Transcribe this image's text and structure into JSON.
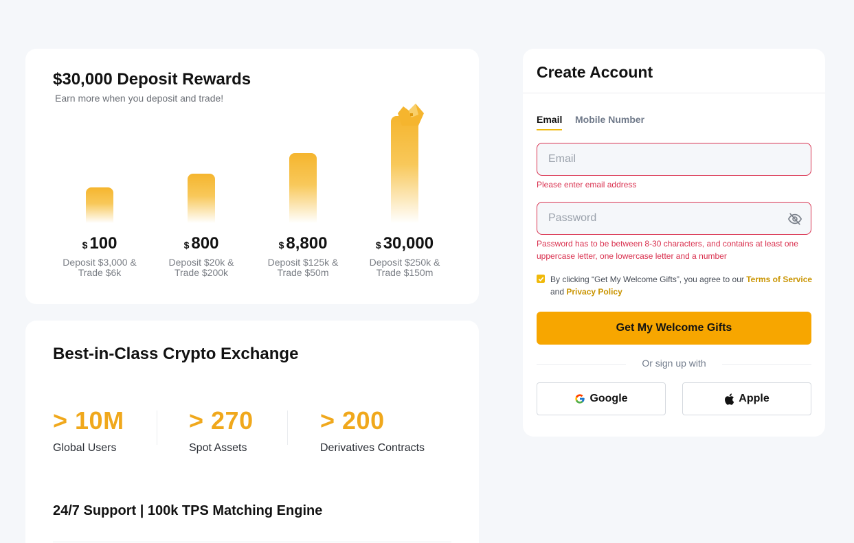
{
  "rewards": {
    "title": "$30,000 Deposit Rewards",
    "subtitle": "Earn more when you deposit and trade!",
    "tiers": [
      {
        "currency": "$",
        "amount": "100",
        "desc_line1": "Deposit $3,000 &",
        "desc_line2": "Trade $6k"
      },
      {
        "currency": "$",
        "amount": "800",
        "desc_line1": "Deposit $20k &",
        "desc_line2": "Trade $200k"
      },
      {
        "currency": "$",
        "amount": "8,800",
        "desc_line1": "Deposit $125k &",
        "desc_line2": "Trade $50m"
      },
      {
        "currency": "$",
        "amount": "30,000",
        "desc_line1": "Deposit $250k &",
        "desc_line2": "Trade $150m"
      }
    ]
  },
  "exchange": {
    "title": "Best-in-Class Crypto Exchange",
    "stats": [
      {
        "value": "> 10M",
        "label": "Global Users"
      },
      {
        "value": "> 270",
        "label": "Spot Assets"
      },
      {
        "value": "> 200",
        "label": "Derivatives Contracts"
      }
    ],
    "footer": "24/7 Support | 100k TPS Matching Engine"
  },
  "signup": {
    "title": "Create Account",
    "tabs": [
      {
        "label": "Email"
      },
      {
        "label": "Mobile Number"
      }
    ],
    "email_placeholder": "Email",
    "email_error": "Please enter email address",
    "password_placeholder": "Password",
    "password_error": "Password has to be between 8-30 characters, and contains at least one uppercase letter, one lowercase letter and a number",
    "agree_prefix": "By clicking “Get My Welcome Gifts”, you agree to our",
    "terms_link": "Terms of Service",
    "agree_and": "and",
    "privacy_link": "Privacy Policy",
    "cta_label": "Get My Welcome Gifts",
    "or_text": "Or sign up with",
    "google_label": "Google",
    "apple_label": "Apple"
  },
  "colors": {
    "accent": "#f7a600",
    "stat": "#f0a81c",
    "error": "#d9304e",
    "link": "#c99400"
  },
  "icons": [
    "crown-icon",
    "eye-off-icon",
    "check-icon",
    "google-icon",
    "apple-icon"
  ]
}
